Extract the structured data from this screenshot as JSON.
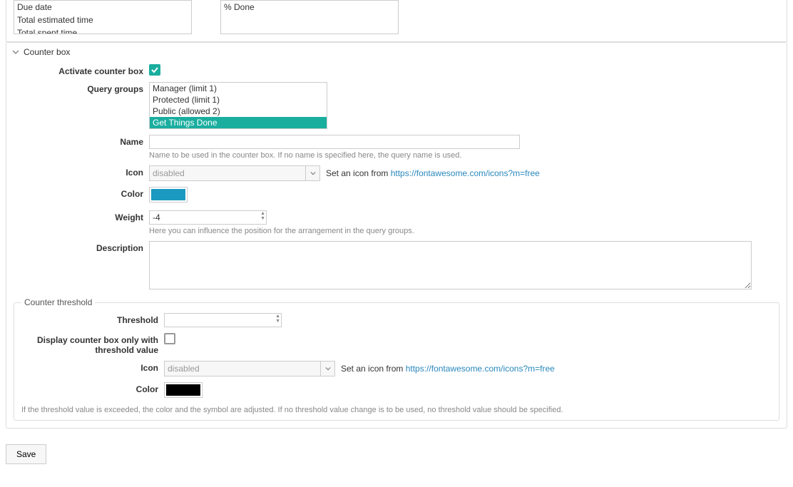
{
  "top": {
    "left_options": [
      "Due date",
      "Total estimated time",
      "Total spent time"
    ],
    "right_options": [
      "% Done"
    ]
  },
  "counter": {
    "legend": "Counter box",
    "activate_label": "Activate counter box",
    "activate_checked": true,
    "query_groups_label": "Query groups",
    "query_groups": [
      "Manager (limit 1)",
      "Protected (limit 1)",
      "Public (allowed 2)",
      "Get Things Done"
    ],
    "query_groups_selected": 3,
    "name_label": "Name",
    "name_value": "",
    "name_help": "Name to be used in the counter box. If no name is specified here, the query name is used.",
    "icon_label": "Icon",
    "icon_value": "disabled",
    "icon_hint_pre": "Set an icon from ",
    "icon_url": "https://fontawesome.com/icons?m=free",
    "color_label": "Color",
    "color_value": "#1c99c0",
    "weight_label": "Weight",
    "weight_value": "-4",
    "weight_help": "Here you can influence the position for the arrangement in the query groups.",
    "description_label": "Description",
    "description_value": ""
  },
  "threshold": {
    "legend": "Counter threshold",
    "threshold_label": "Threshold",
    "threshold_value": "",
    "display_label": "Display counter box only with threshold value",
    "display_checked": false,
    "icon_label": "Icon",
    "icon_value": "disabled",
    "icon_hint_pre": "Set an icon from ",
    "icon_url": "https://fontawesome.com/icons?m=free",
    "color_label": "Color",
    "color_value": "#000000",
    "help": "If the threshold value is exceeded, the color and the symbol are adjusted. If no threshold value change is to be used, no threshold value should be specified."
  },
  "save_label": "Save"
}
